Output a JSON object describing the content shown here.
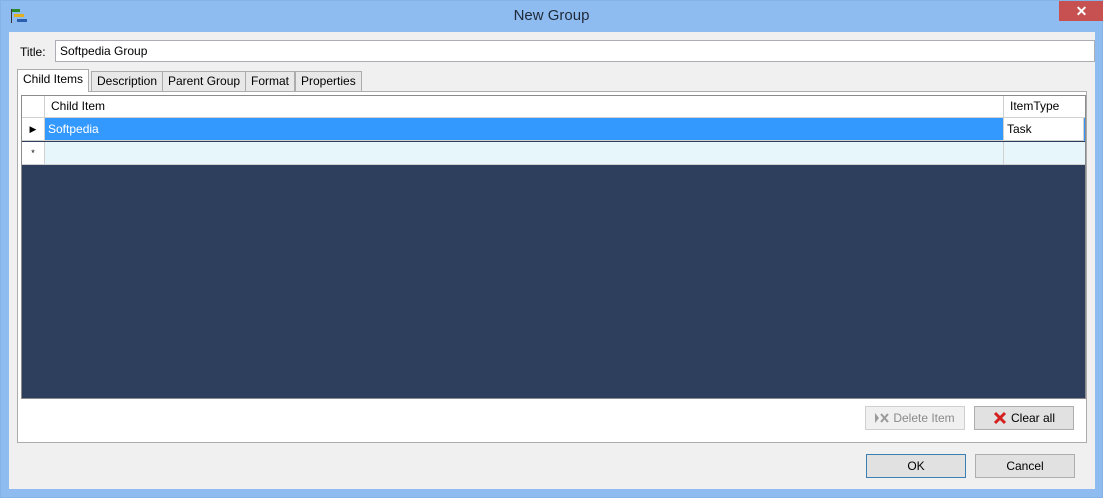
{
  "window": {
    "title": "New Group",
    "close_glyph": "✕"
  },
  "form": {
    "title_label": "Title:",
    "title_value": "Softpedia Group"
  },
  "tabs": [
    {
      "label": "Child Items",
      "active": true
    },
    {
      "label": "Description",
      "active": false
    },
    {
      "label": "Parent Group",
      "active": false
    },
    {
      "label": "Format",
      "active": false
    },
    {
      "label": "Properties",
      "active": false
    }
  ],
  "grid": {
    "columns": [
      "Child Item",
      "ItemType"
    ],
    "rows": [
      {
        "indicator": "▶",
        "child_item": "Softpedia",
        "item_type": "Task"
      },
      {
        "indicator": "*",
        "child_item": "",
        "item_type": ""
      }
    ]
  },
  "actions": {
    "delete_label": "Delete Item",
    "clear_label": "Clear all",
    "ok_label": "OK",
    "cancel_label": "Cancel"
  },
  "colors": {
    "titlebar": "#8fbcf0",
    "selection": "#3399ff",
    "grid_background": "#2e3f5e",
    "close_button": "#c75050"
  }
}
